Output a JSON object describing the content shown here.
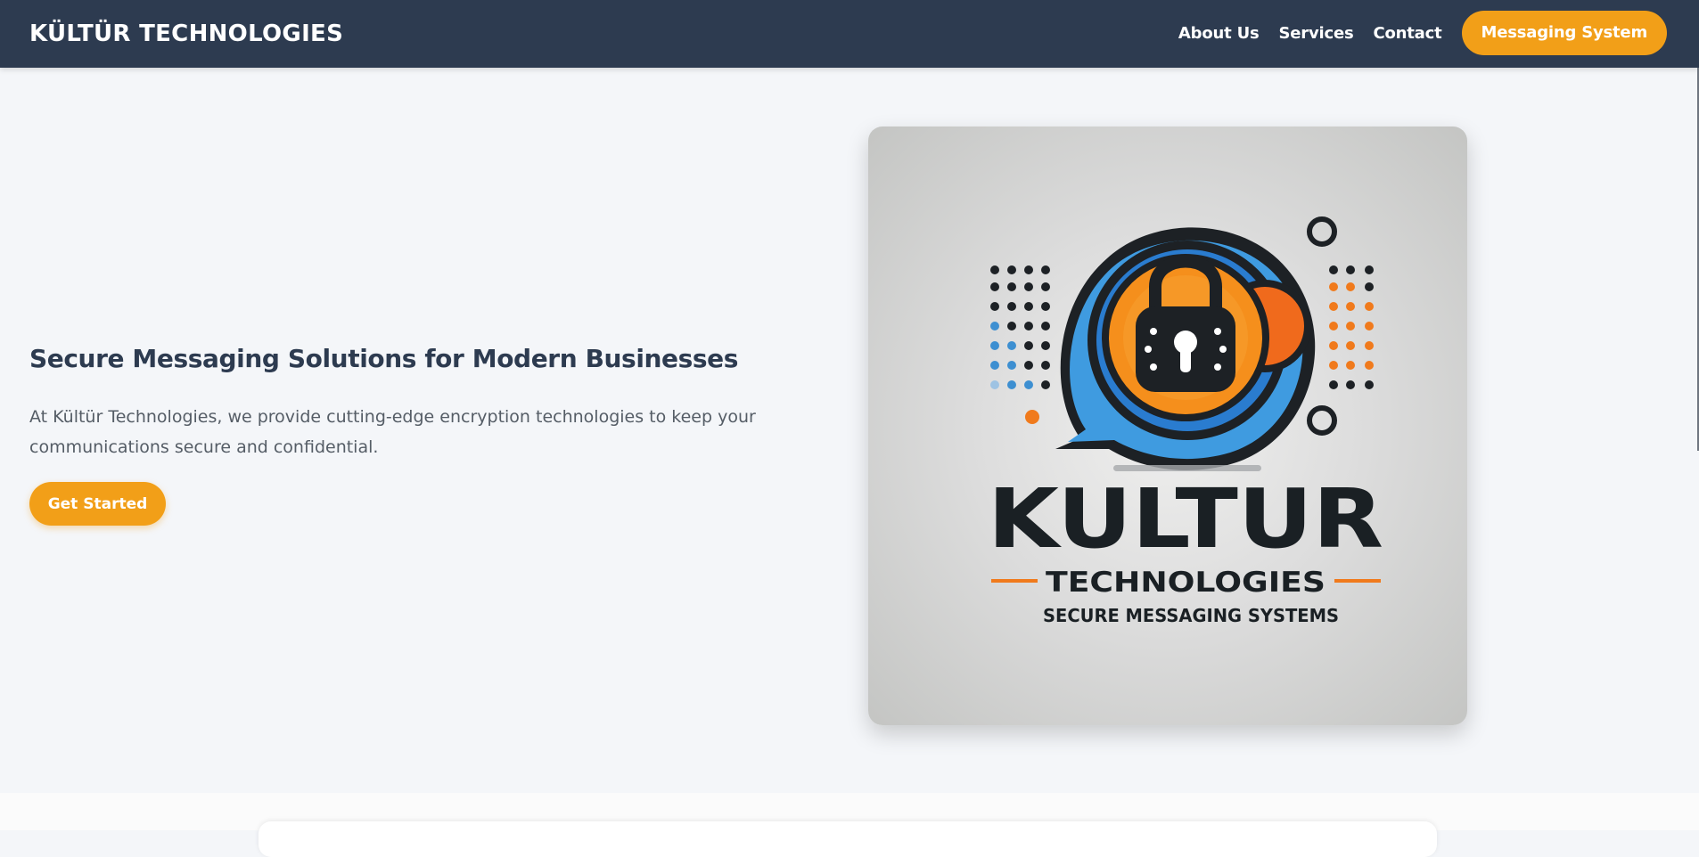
{
  "header": {
    "brand": "KÜLTÜR TECHNOLOGIES",
    "nav": [
      {
        "label": "About Us"
      },
      {
        "label": "Services"
      },
      {
        "label": "Contact"
      }
    ],
    "cta_label": "Messaging System"
  },
  "hero": {
    "title": "Secure Messaging Solutions for Modern Businesses",
    "text": "At Kültür Technologies, we provide cutting-edge encryption technologies to keep your communications secure and confidential.",
    "button_label": "Get Started"
  },
  "logo": {
    "wordmark": "KULTUR",
    "subtitle": "TECHNOLOGIES",
    "tagline": "SECURE MESSAGING SYSTEMS"
  },
  "colors": {
    "navbar": "#2d3b50",
    "accent": "#f29f18",
    "background": "#f4f6f9",
    "heading": "#2d3b50",
    "body_text": "#555d66"
  }
}
